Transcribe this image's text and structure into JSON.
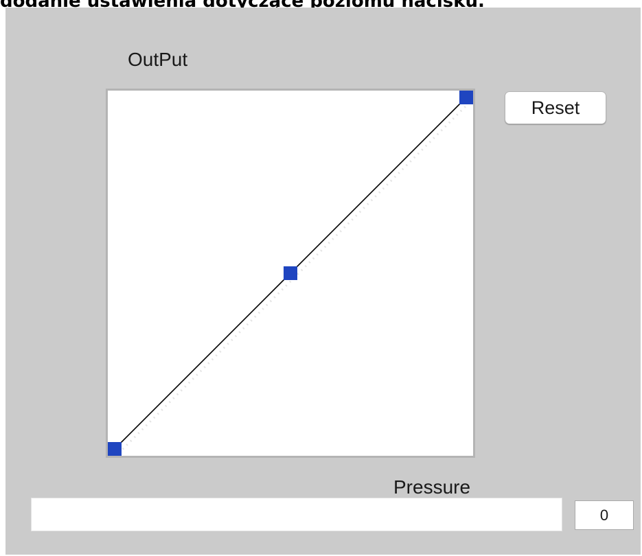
{
  "caption": "dodanie ustawienia dotyczące poziomu nacisku.",
  "graph": {
    "label": "OutPut",
    "control_points": [
      {
        "pressure": 0,
        "output": 0
      },
      {
        "pressure": 0.5,
        "output": 0.5
      },
      {
        "pressure": 1,
        "output": 1
      }
    ],
    "point_color": "#1f45c0",
    "line_color": "#000000"
  },
  "reset_button": {
    "label": "Reset"
  },
  "pressure": {
    "label": "Pressure",
    "value": "0",
    "level": 0
  }
}
